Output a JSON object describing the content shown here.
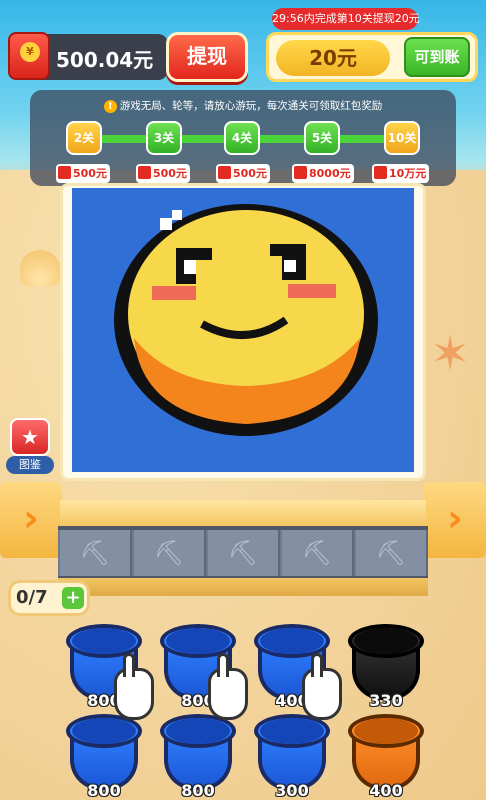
{
  "top_bar": {
    "balance": "500.04元",
    "coin_symbol": "¥",
    "withdraw_label": "提现",
    "timer_text": "29:56内完成第10关提现20元",
    "reward_amount": "20元",
    "arrive_label": "可到账"
  },
  "level_panel": {
    "notice": "游戏无局、轮等，请放心游玩，每次通关可领取红包奖励",
    "notice_icon": "!",
    "levels": [
      {
        "label": "2关",
        "prize": "500元"
      },
      {
        "label": "3关",
        "prize": "500元"
      },
      {
        "label": "4关",
        "prize": "500元"
      },
      {
        "label": "5关",
        "prize": "8000元"
      },
      {
        "label": "10关",
        "prize": "10万元"
      }
    ]
  },
  "album": {
    "label": "图鉴",
    "icon": "star-icon"
  },
  "counter": {
    "text": "0/7",
    "add_label": "+"
  },
  "buckets": [
    {
      "count": "800",
      "color": "blue"
    },
    {
      "count": "800",
      "color": "blue"
    },
    {
      "count": "400",
      "color": "blue"
    },
    {
      "count": "330",
      "color": "black"
    },
    {
      "count": "800",
      "color": "blue"
    },
    {
      "count": "800",
      "color": "blue"
    },
    {
      "count": "300",
      "color": "blue"
    },
    {
      "count": "400",
      "color": "orange"
    }
  ],
  "colors": {
    "sky": "#37b7e8",
    "sand": "#f3d9a2",
    "pixel_blue": "#2f6fd6",
    "pixel_yellow": "#f6d84a",
    "pixel_orange": "#f4841c",
    "pixel_black": "#111111",
    "accent_red": "#e2261e",
    "accent_green": "#3ab526"
  }
}
